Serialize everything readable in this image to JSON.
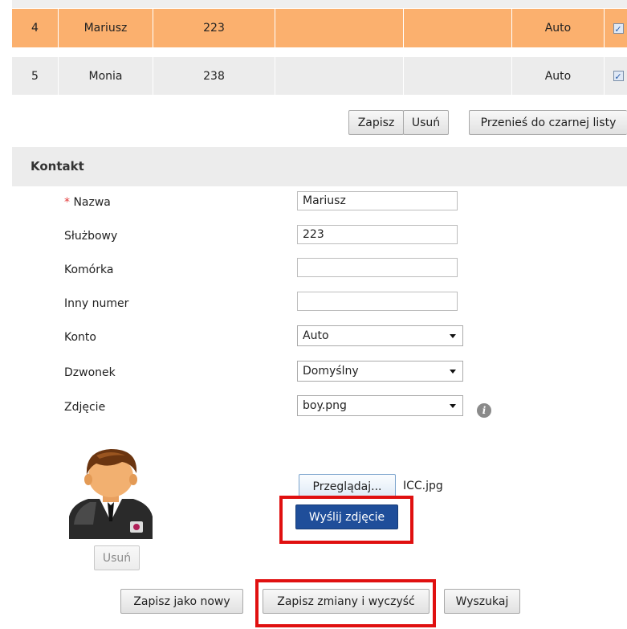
{
  "table": {
    "rows": [
      {
        "num": "4",
        "name": "Mariusz",
        "ext": "223",
        "col4": "",
        "col5": "",
        "account": "Auto",
        "checked": "✓",
        "selected": true
      },
      {
        "num": "5",
        "name": "Monia",
        "ext": "238",
        "col4": "",
        "col5": "",
        "account": "Auto",
        "checked": "✓",
        "selected": false
      }
    ],
    "buttons": {
      "save": "Zapisz",
      "delete": "Usuń",
      "blacklist": "Przenieś do czarnej listy"
    }
  },
  "contact": {
    "title": "Kontakt",
    "required_mark": "*",
    "fields": {
      "name": {
        "label": "Nazwa",
        "value": "Mariusz"
      },
      "work": {
        "label": "Służbowy",
        "value": "223"
      },
      "mobile": {
        "label": "Komórka",
        "value": ""
      },
      "other": {
        "label": "Inny numer",
        "value": ""
      },
      "account": {
        "label": "Konto",
        "value": "Auto"
      },
      "ringtone": {
        "label": "Dzwonek",
        "value": "Domyślny"
      },
      "photo": {
        "label": "Zdjęcie",
        "value": "boy.png"
      }
    },
    "photo_delete": "Usuń",
    "browse": "Przeglądaj...",
    "file_name": "ICC.jpg",
    "upload": "Wyślij zdjęcie",
    "info_icon": "i"
  },
  "footer": {
    "save_new": "Zapisz jako nowy",
    "save_clear": "Zapisz zmiany i wyczyść",
    "search": "Wyszukaj"
  },
  "colors": {
    "selected_row": "#fbb06e",
    "normal_row": "#ececec",
    "highlight": "#e01010",
    "upload_button": "#1f4e9a"
  }
}
